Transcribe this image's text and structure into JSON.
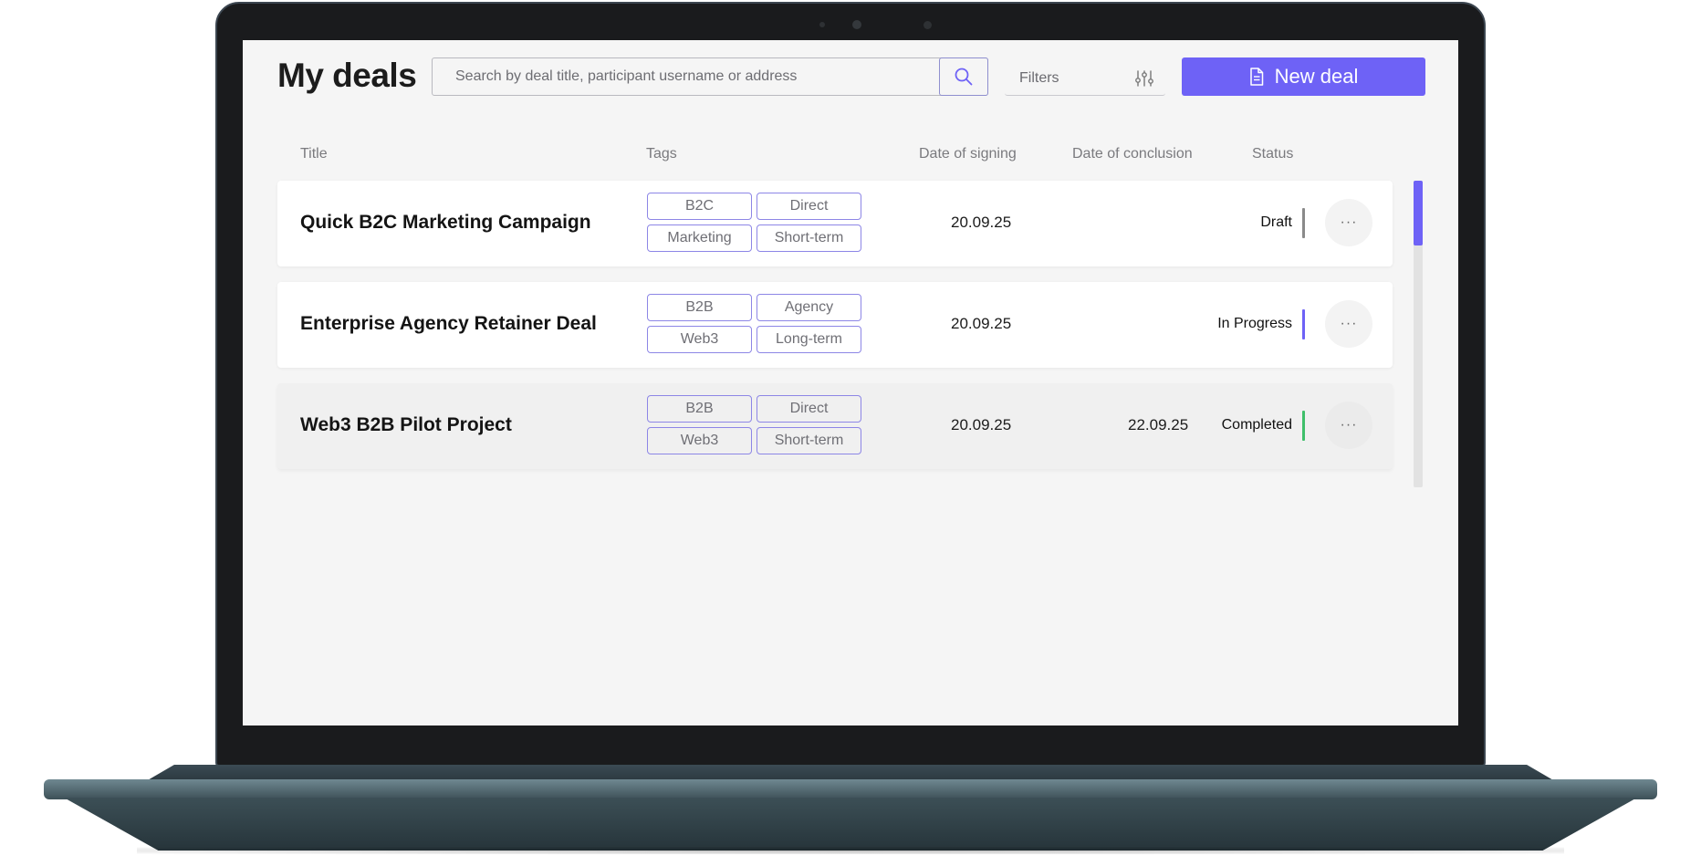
{
  "header": {
    "title": "My deals",
    "search_placeholder": "Search by deal title, participant username or address",
    "filters_label": "Filters",
    "new_deal_label": "New deal"
  },
  "columns": {
    "title": "Title",
    "tags": "Tags",
    "date_signing": "Date of signing",
    "date_conclusion": "Date of conclusion",
    "status": "Status"
  },
  "deals": [
    {
      "title": "Quick B2C Marketing Campaign",
      "tags": [
        "B2C",
        "Direct",
        "Marketing",
        "Short-term"
      ],
      "date_signing": "20.09.25",
      "date_conclusion": "",
      "status": "Draft",
      "status_color": "#8a8a8a",
      "more": "···"
    },
    {
      "title": "Enterprise Agency Retainer Deal",
      "tags": [
        "B2B",
        "Agency",
        "Web3",
        "Long-term"
      ],
      "date_signing": "20.09.25",
      "date_conclusion": "",
      "status": "In Progress",
      "status_color": "#6e62f6",
      "more": "···"
    },
    {
      "title": "Web3 B2B Pilot Project",
      "tags": [
        "B2B",
        "Direct",
        "Web3",
        "Short-term"
      ],
      "date_signing": "20.09.25",
      "date_conclusion": "22.09.25",
      "status": "Completed",
      "status_color": "#3fbf6a",
      "more": "···"
    }
  ],
  "colors": {
    "accent": "#6e62f6",
    "screen_bg": "#f5f5f5",
    "tag_border": "#8d86e6"
  },
  "icons": {
    "search": "search-icon",
    "filters": "sliders-icon",
    "new_deal": "document-icon",
    "more": "more-dots-icon"
  }
}
